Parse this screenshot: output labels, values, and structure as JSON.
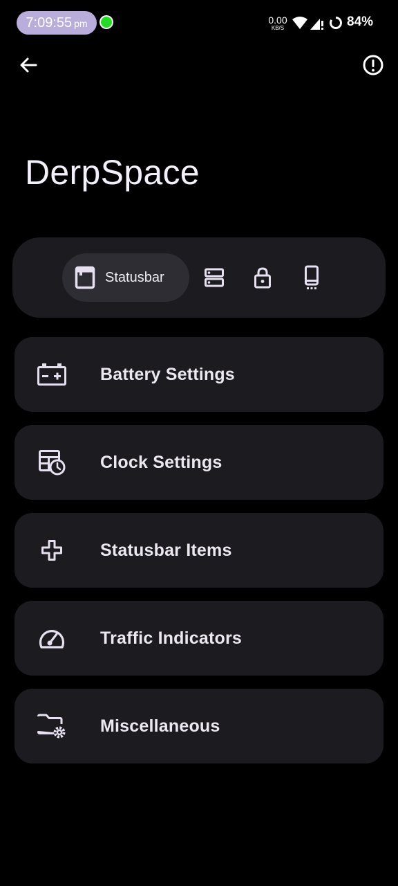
{
  "status_bar": {
    "time": "7:09:55",
    "ampm": "pm",
    "net_speed_value": "0.00",
    "net_speed_unit": "KB/S",
    "battery_percent": "84%",
    "icons": [
      "green-dot",
      "wifi-icon",
      "signal-icon",
      "battery-ring-icon"
    ],
    "colors": {
      "clock_pill": "#b8addb",
      "dot": "#22dd22"
    }
  },
  "app_bar": {
    "icons": [
      "back-arrow-icon",
      "info-icon"
    ]
  },
  "page": {
    "title": "DerpSpace"
  },
  "tabs": {
    "active_label": "Statusbar",
    "items": [
      {
        "icon": "statusbar-icon",
        "label": "Statusbar",
        "selected": true
      },
      {
        "icon": "quick-settings-icon"
      },
      {
        "icon": "lock-icon"
      },
      {
        "icon": "phone-icon"
      }
    ]
  },
  "menu": {
    "items": [
      {
        "label": "Battery Settings",
        "icon": "battery-icon"
      },
      {
        "label": "Clock Settings",
        "icon": "clock-calendar-icon"
      },
      {
        "label": "Statusbar Items",
        "icon": "plus-outline-icon"
      },
      {
        "label": "Traffic Indicators",
        "icon": "speedometer-icon"
      },
      {
        "label": "Miscellaneous",
        "icon": "folder-settings-icon"
      }
    ]
  },
  "colors": {
    "background": "#000000",
    "surface": "#1c1b1f",
    "surface_selected": "#2e2d33",
    "on_surface": "#ece8f2",
    "icon_tint": "#e6e0f0"
  }
}
